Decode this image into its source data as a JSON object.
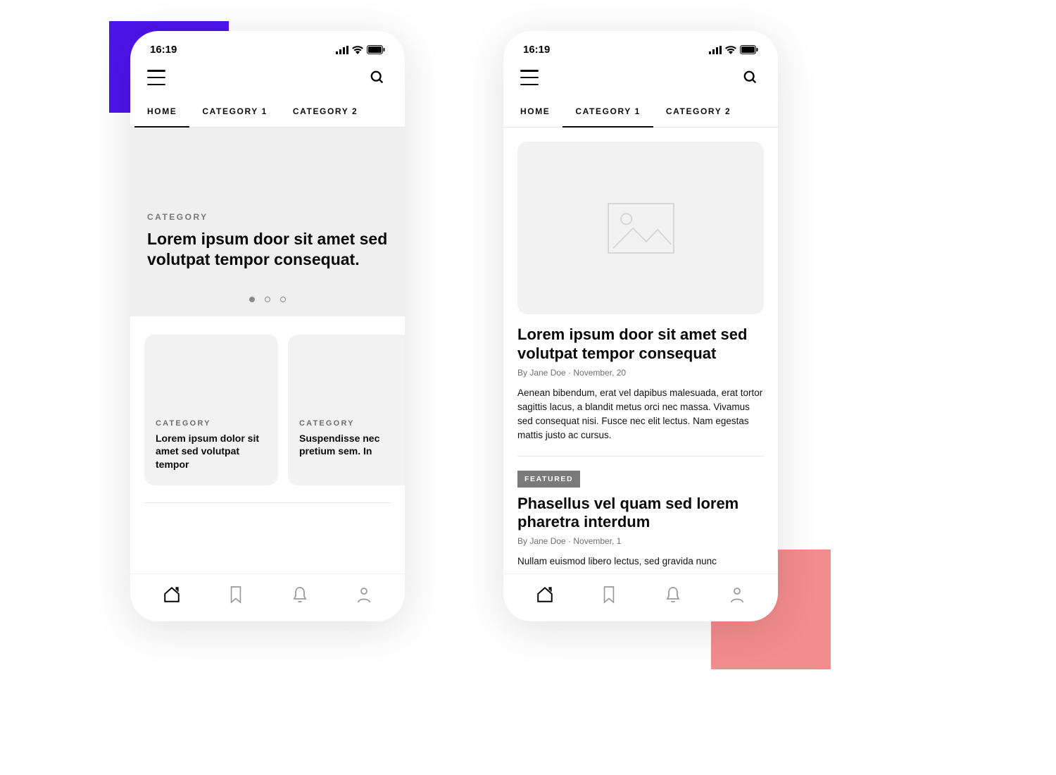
{
  "status": {
    "time": "16:19"
  },
  "tabs": [
    {
      "label": "HOME"
    },
    {
      "label": "CATEGORY 1"
    },
    {
      "label": "CATEGORY 2"
    }
  ],
  "screenA": {
    "hero": {
      "category": "CATEGORY",
      "title": "Lorem ipsum door sit amet sed volutpat tempor consequat."
    },
    "cards": [
      {
        "category": "CATEGORY",
        "title": "Lorem ipsum dolor sit amet sed volutpat tempor"
      },
      {
        "category": "CATEGORY",
        "title": "Suspendisse nec pretium sem. In"
      }
    ]
  },
  "screenB": {
    "article1": {
      "title": "Lorem ipsum door sit amet sed volutpat tempor consequat",
      "byline": "By Jane Doe · November, 20",
      "body": "Aenean bibendum, erat vel dapibus malesuada, erat tortor sagittis lacus, a blandit metus orci nec massa. Vivamus sed consequat nisi. Fusce nec elit lectus. Nam egestas mattis justo ac cursus."
    },
    "featured_label": "FEATURED",
    "article2": {
      "title": "Phasellus vel quam sed lorem pharetra interdum",
      "byline": "By Jane Doe · November, 1",
      "body": "Nullam euismod libero lectus, sed gravida nunc"
    }
  }
}
